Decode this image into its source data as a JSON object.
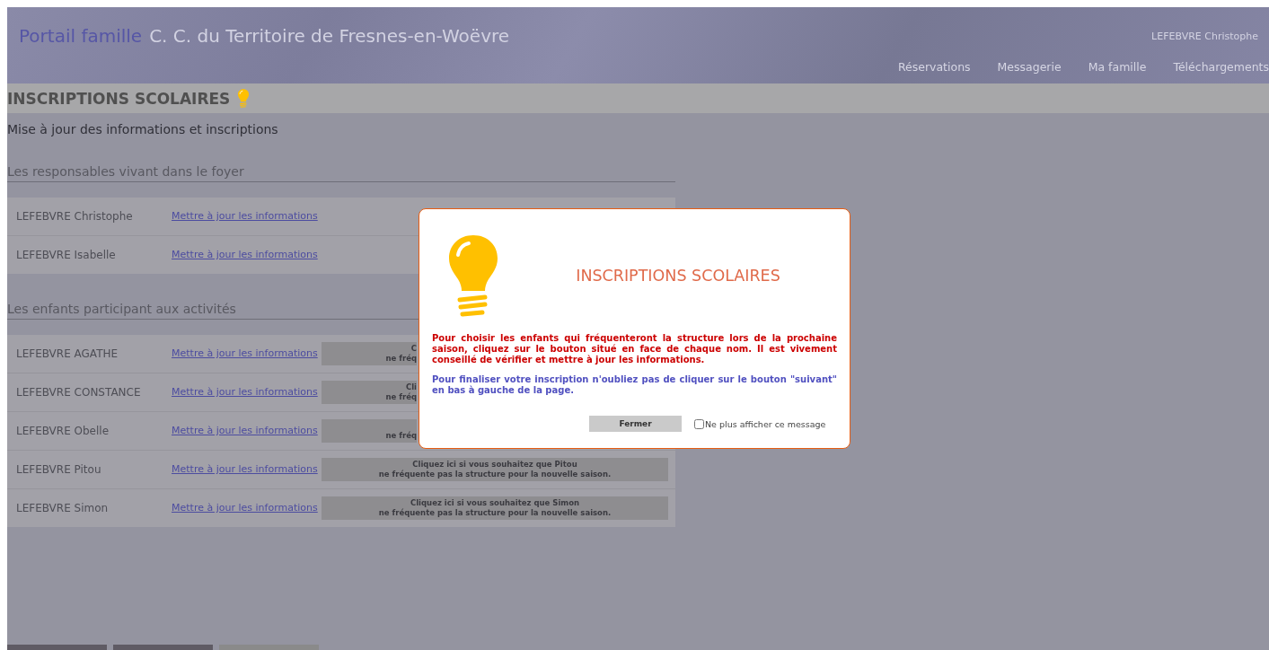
{
  "header": {
    "portal": "Portail famille",
    "title": "C. C. du Territoire de Fresnes-en-Woëvre",
    "user": "LEFEBVRE Christophe",
    "nav": [
      {
        "label": "Réservations"
      },
      {
        "label": "Messagerie"
      },
      {
        "label": "Ma famille"
      },
      {
        "label": "Téléchargements"
      }
    ]
  },
  "page_title": "INSCRIPTIONS SCOLAIRES",
  "subtitle": "Mise à jour des informations et inscriptions",
  "sections": [
    {
      "heading": "Les responsables vivant dans le foyer",
      "rows": [
        {
          "name": "LEFEBVRE Christophe",
          "link": "Mettre à jour les informations"
        },
        {
          "name": "LEFEBVRE Isabelle",
          "link": "Mettre à jour les informations"
        }
      ]
    },
    {
      "heading": "Les enfants participant aux activités",
      "rows": [
        {
          "name": "LEFEBVRE AGATHE",
          "link": "Mettre à jour les informations",
          "button": {
            "kind": "partial",
            "lines": [
              "C",
              "ne fréq"
            ]
          }
        },
        {
          "name": "LEFEBVRE CONSTANCE",
          "link": "Mettre à jour les informations",
          "button": {
            "kind": "partial",
            "lines": [
              "Cli",
              "ne fréq"
            ]
          }
        },
        {
          "name": "LEFEBVRE Obelle",
          "link": "Mettre à jour les informations",
          "button": {
            "kind": "partial",
            "lines": [
              "ne fréq"
            ]
          }
        },
        {
          "name": "LEFEBVRE Pitou",
          "link": "Mettre à jour les informations",
          "button": {
            "kind": "full",
            "lines": [
              "Cliquez ici si vous souhaitez que Pitou",
              "ne fréquente pas la structure pour la nouvelle saison."
            ]
          }
        },
        {
          "name": "LEFEBVRE Simon",
          "link": "Mettre à jour les informations",
          "button": {
            "kind": "full",
            "lines": [
              "Cliquez ici si vous souhaitez que Simon",
              "ne fréquente pas la structure pour la nouvelle saison."
            ]
          }
        }
      ]
    }
  ],
  "footer_buttons": [
    {
      "kind": "dark"
    },
    {
      "kind": "dark"
    },
    {
      "kind": "light"
    }
  ],
  "dialog": {
    "title": "INSCRIPTIONS SCOLAIRES",
    "message": "Pour choisir les enfants qui fréquenteront la structure lors de la prochaine saison, cliquez sur le bouton situé en face de chaque nom. Il est vivement conseillé de vérifier et mettre à jour les informations.",
    "note": "Pour finaliser votre inscription n'oubliez pas de cliquer sur le bouton \"suivant\" en bas à gauche de la page.",
    "close": "Fermer",
    "dont_show": {
      "label": "Ne plus afficher ce message",
      "checked": false
    }
  }
}
